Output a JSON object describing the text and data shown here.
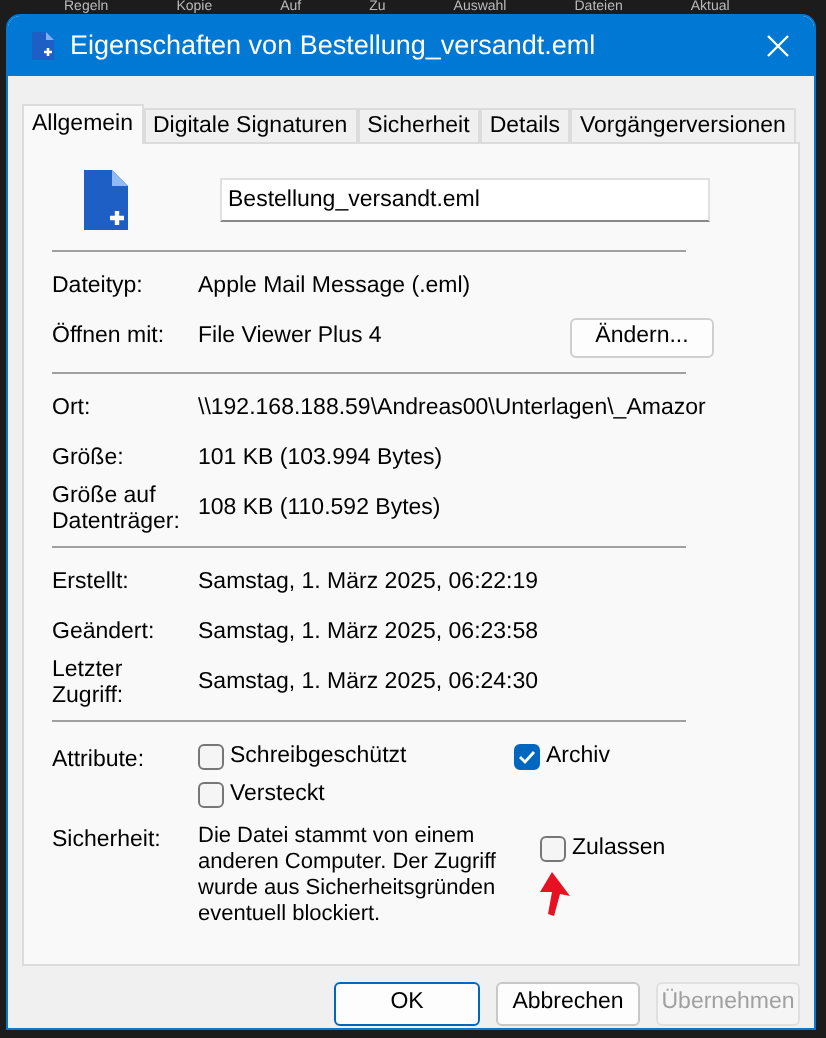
{
  "background_menu": [
    "Regeln",
    "Kopie",
    "Auf",
    "Zu",
    "Auswahl",
    "Dateien",
    "Aktual"
  ],
  "window": {
    "title": "Eigenschaften von Bestellung_versandt.eml"
  },
  "tabs": [
    {
      "label": "Allgemein",
      "selected": true
    },
    {
      "label": "Digitale Signaturen",
      "selected": false
    },
    {
      "label": "Sicherheit",
      "selected": false
    },
    {
      "label": "Details",
      "selected": false
    },
    {
      "label": "Vorgängerversionen",
      "selected": false
    }
  ],
  "file_name": {
    "value": "Bestellung_versandt.eml"
  },
  "sections": [
    [
      {
        "label": "Dateityp:",
        "value": "Apple Mail Message (.eml)"
      },
      {
        "label": "Öffnen mit:",
        "value": "File Viewer Plus 4",
        "button": "Ändern..."
      }
    ],
    [
      {
        "label": "Ort:",
        "value": "\\\\192.168.188.59\\Andreas00\\Unterlagen\\_Amazor"
      },
      {
        "label": "Größe:",
        "value": "101 KB (103.994 Bytes)"
      },
      {
        "label": "Größe auf\nDatenträger:",
        "value": "108 KB (110.592 Bytes)"
      }
    ],
    [
      {
        "label": "Erstellt:",
        "value": "Samstag, 1. März 2025, 06:22:19"
      },
      {
        "label": "Geändert:",
        "value": "Samstag, 1. März 2025, 06:23:58"
      },
      {
        "label": "Letzter\nZugriff:",
        "value": "Samstag, 1. März 2025, 06:24:30"
      }
    ]
  ],
  "attributes": {
    "label": "Attribute:",
    "items": [
      {
        "label": "Schreibgeschützt",
        "checked": false
      },
      {
        "label": "Archiv",
        "checked": true
      },
      {
        "label": "Versteckt",
        "checked": false
      }
    ]
  },
  "security": {
    "label": "Sicherheit:",
    "text": "Die Datei stammt von einem anderen Computer. Der Zugriff wurde aus Sicherheitsgründen eventuell blockiert.",
    "checkbox": {
      "label": "Zulassen",
      "checked": false
    }
  },
  "buttons": [
    {
      "label": "OK",
      "kind": "default"
    },
    {
      "label": "Abbrechen",
      "kind": "normal"
    },
    {
      "label": "Übernehmen",
      "kind": "disabled"
    }
  ]
}
